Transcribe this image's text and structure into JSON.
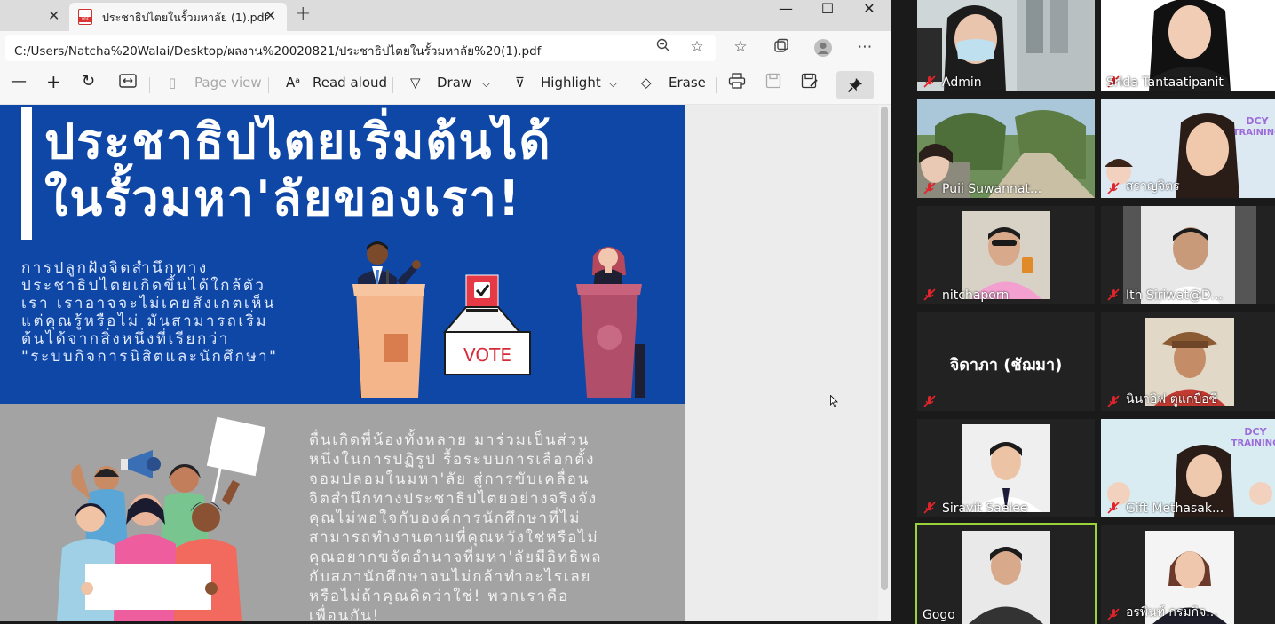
{
  "browser": {
    "tab_title": "ประชาธิปไตยในรั้วมหาลัย (1).pdf",
    "address": "C:/Users/Natcha%20Walai/Desktop/ผลงาน%20020821/ประชาธิปไตยในรั้วมหาลัย%20(1).pdf"
  },
  "toolbar": {
    "page_view": "Page view",
    "read_aloud": "Read aloud",
    "draw": "Draw",
    "highlight": "Highlight",
    "erase": "Erase"
  },
  "document": {
    "title_line1": "ประชาธิปไตยเริ่มต้นได้",
    "title_line2": "ในรั้วมหา'ลัยของเรา!",
    "intro_lines": [
      "การปลูกฝังจิตสำนึกทาง",
      "ประชาธิปไตยเกิดขึ้นได้ใกล้ตัว",
      "เรา เราอาจจะไม่เคยสังเกตเห็น",
      "แต่คุณรู้หรือไม่ มันสามารถเริ่ม",
      "ต้นได้จากสิ่งหนึ่งที่เรียกว่า",
      "\"ระบบกิจการนิสิตและนักศึกษา\""
    ],
    "vote_label": "VOTE",
    "body_lines": [
      "ตื่นเกิดพี่น้องทั้งหลาย มาร่วมเป็นส่วน",
      "หนึ่งในการปฏิรูป รื้อระบบการเลือกตั้ง",
      "จอมปลอมในมหา'ลัย สู่การขับเคลื่อน",
      "จิตสำนึกทางประชาธิปไตยอย่างจริงจัง",
      "คุณไม่พอใจกับองค์การนักศึกษาที่ไม่",
      "สามารถทำงานตามที่คุณหวังใช่หรือไม่",
      "คุณอยากขจัดอำนาจที่มหา'ลัยมีอิทธิพล",
      "กับสภานักศึกษาจนไม่กล้าทำอะไรเลย",
      "หรือไม่ถ้าคุณคิดว่าใช่! พวกเราคือ",
      "เพื่อนกัน!"
    ]
  },
  "participants": [
    {
      "name": "Admin"
    },
    {
      "name": "Srida Tantaatipanit"
    },
    {
      "name": "Puii Suwannat..."
    },
    {
      "name": "สราญจิตร"
    },
    {
      "name": "nitchaporn"
    },
    {
      "name": "Ith Siriwat@D..."
    },
    {
      "name": "",
      "display_name": "จิดาภา (ชัฌมา)"
    },
    {
      "name": "นินาอิฟ ตูแกบือซี"
    },
    {
      "name": "Siravit Saelee"
    },
    {
      "name": "Gift Methasak..."
    },
    {
      "name": "Gogo"
    },
    {
      "name": "อรพินท์ กรมกิจ..."
    }
  ],
  "colors": {
    "doc_blue": "#0f47a7",
    "doc_gray": "#a3a3a3",
    "active_speaker": "#9ad23c",
    "muted_red": "#e0242b"
  }
}
